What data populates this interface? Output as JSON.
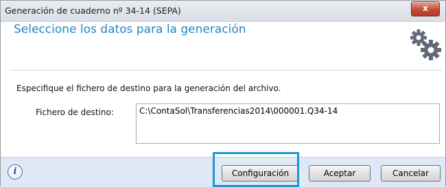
{
  "window": {
    "title": "Generación de cuaderno nº 34-14 (SEPA)",
    "close_label": "x"
  },
  "header": {
    "heading": "Seleccione los datos para la generación",
    "icon": "gears-icon"
  },
  "form": {
    "instruction": "Especifique el fichero de destino para la generación del archivo.",
    "destination_label": "Fichero de destino:",
    "destination_value": "C:\\ContaSol\\Transferencias2014\\000001.Q34-14"
  },
  "footer": {
    "info_icon_glyph": "i",
    "buttons": {
      "configuration": "Configuración",
      "accept": "Aceptar",
      "cancel": "Cancelar"
    }
  },
  "colors": {
    "heading": "#1e86c8",
    "footer_bg": "#dfe8f6",
    "highlight": "#1b96d4",
    "close_btn": "#c24b37"
  }
}
